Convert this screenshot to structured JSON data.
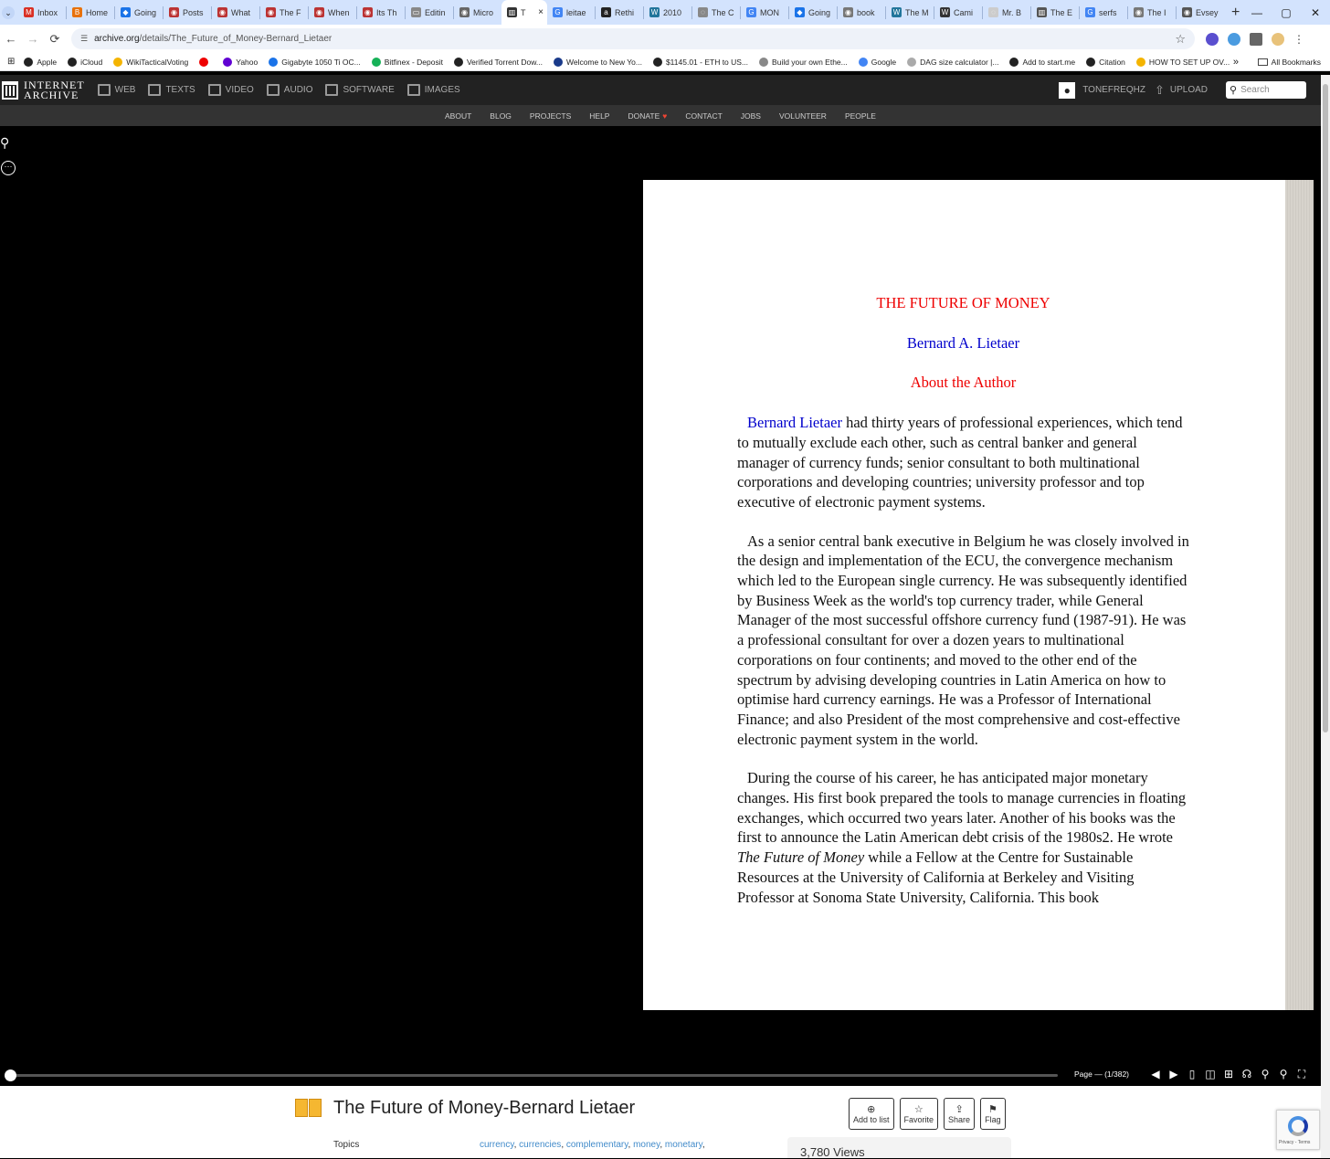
{
  "browser": {
    "tabs": [
      {
        "label": "Inbox",
        "color": "#d93025",
        "glyph": "M"
      },
      {
        "label": "Home",
        "color": "#e8710a",
        "glyph": "B"
      },
      {
        "label": "Going",
        "color": "#1a73e8",
        "glyph": "◆"
      },
      {
        "label": "Posts",
        "color": "#b33",
        "glyph": "◉"
      },
      {
        "label": "What",
        "color": "#b33",
        "glyph": "◉"
      },
      {
        "label": "The F",
        "color": "#b33",
        "glyph": "◉"
      },
      {
        "label": "When",
        "color": "#b33",
        "glyph": "◉"
      },
      {
        "label": "Its Th",
        "color": "#b33",
        "glyph": "◉"
      },
      {
        "label": "Editin",
        "color": "#888",
        "glyph": "▭"
      },
      {
        "label": "Micro",
        "color": "#666",
        "glyph": "◉"
      },
      {
        "label": "T",
        "color": "#333",
        "glyph": "▥",
        "active": true
      },
      {
        "label": "leitae",
        "color": "#4285f4",
        "glyph": "G"
      },
      {
        "label": "Rethi",
        "color": "#222",
        "glyph": "a"
      },
      {
        "label": "2010",
        "color": "#21759b",
        "glyph": "W"
      },
      {
        "label": "The C",
        "color": "#888",
        "glyph": "◌"
      },
      {
        "label": "MON",
        "color": "#4285f4",
        "glyph": "G"
      },
      {
        "label": "Going",
        "color": "#1a73e8",
        "glyph": "◆"
      },
      {
        "label": "book",
        "color": "#777",
        "glyph": "◉"
      },
      {
        "label": "The M",
        "color": "#21759b",
        "glyph": "W"
      },
      {
        "label": "Cami",
        "color": "#333",
        "glyph": "W"
      },
      {
        "label": "Mr. B",
        "color": "#ccc",
        "glyph": "◌"
      },
      {
        "label": "The E",
        "color": "#555",
        "glyph": "▥"
      },
      {
        "label": "serfs",
        "color": "#4285f4",
        "glyph": "G"
      },
      {
        "label": "The I",
        "color": "#777",
        "glyph": "◉"
      },
      {
        "label": "Evsey",
        "color": "#555",
        "glyph": "◉"
      }
    ],
    "close_tab_glyph": "×",
    "new_tab_glyph": "+",
    "window_controls": [
      "⌄",
      "—",
      "▢",
      "✕"
    ],
    "nav": {
      "back": "←",
      "forward": "→",
      "reload": "⟳"
    },
    "url_host": "archive.org",
    "url_path": "/details/The_Future_of_Money-Bernard_Lietaer",
    "bookmark_star": "☆",
    "bookmarks": [
      {
        "label": "Apple",
        "color": "#222"
      },
      {
        "label": "iCloud",
        "color": "#222"
      },
      {
        "label": "WikiTacticalVoting",
        "color": "#f4b400"
      },
      {
        "label": "",
        "color": "#e00"
      },
      {
        "label": "Yahoo",
        "color": "#6001d2"
      },
      {
        "label": "Gigabyte 1050 Ti OC...",
        "color": "#1a73e8"
      },
      {
        "label": "Bitfinex - Deposit",
        "color": "#16b157"
      },
      {
        "label": "Verified Torrent Dow...",
        "color": "#222"
      },
      {
        "label": "Welcome to New Yo...",
        "color": "#1a3a8a"
      },
      {
        "label": "$1145.01 - ETH to US...",
        "color": "#222"
      },
      {
        "label": "Build your own Ethe...",
        "color": "#888"
      },
      {
        "label": "Google",
        "color": "#4285f4"
      },
      {
        "label": "DAG size calculator |...",
        "color": "#aaa"
      },
      {
        "label": "Add to start.me",
        "color": "#222"
      },
      {
        "label": "Citation",
        "color": "#222"
      },
      {
        "label": "HOW TO SET UP OV...",
        "color": "#f4b400"
      }
    ],
    "bookmarks_more": "»",
    "all_bookmarks": "All Bookmarks"
  },
  "ia_nav": {
    "logo_line1": "INTERNET",
    "logo_line2": "ARCHIVE",
    "media": [
      "WEB",
      "TEXTS",
      "VIDEO",
      "AUDIO",
      "SOFTWARE",
      "IMAGES"
    ],
    "user": "TONEFREQHZ",
    "upload": "UPLOAD",
    "search_placeholder": "Search",
    "sub": [
      "ABOUT",
      "BLOG",
      "PROJECTS",
      "HELP",
      "DONATE",
      "CONTACT",
      "JOBS",
      "VOLUNTEER",
      "PEOPLE"
    ]
  },
  "reader": {
    "page": {
      "title": "THE FUTURE OF MONEY",
      "author": "Bernard A. Lietaer",
      "about": "About the Author",
      "p1_link": "Bernard Lietaer",
      "p1_rest": " had thirty years of professional experiences, which tend to mutually exclude each other, such as central banker and general manager of currency funds; senior consultant to both multinational corporations and developing countries; university professor and top executive of electronic payment systems.",
      "p2": "As a senior central bank executive in Belgium he was closely involved in the design and implementation of the ECU, the convergence mechanism which led to the European single currency. He was subsequently identified by Business Week as the world's top currency trader, while General Manager of the most successful offshore currency fund (1987-91). He was a professional consultant for over a dozen years to multinational corporations on four continents; and moved to the other end of the spectrum by advising developing countries in Latin America on how to optimise hard currency earnings. He was a Professor of International Finance; and also President of the most comprehensive and cost-effective electronic payment system in the world.",
      "p3_a": "During the course of his career, he has anticipated major monetary changes. His first book prepared the tools to manage currencies in floating exchanges, which occurred two years later. Another of his books was the first to announce the Latin American debt crisis of the 1980s2. He wrote ",
      "p3_italic": "The Future of Money",
      "p3_b": " while a Fellow at the Centre for Sustainable Resources at the University of California at Berkeley and Visiting Professor at Sonoma State University, California. This book"
    },
    "page_indicator": "Page — (1/382)",
    "progress": 0.0026
  },
  "meta": {
    "title": "The Future of Money-Bernard Lietaer",
    "actions": [
      {
        "icon": "⊕",
        "label": "Add to list"
      },
      {
        "icon": "☆",
        "label": "Favorite"
      },
      {
        "icon": "⇪",
        "label": "Share"
      },
      {
        "icon": "⚑",
        "label": "Flag"
      }
    ],
    "topics_label": "Topics",
    "topics": [
      "currency",
      "currencies",
      "complementary",
      "money",
      "monetary"
    ],
    "views": "3,780 Views",
    "recaptcha_text": "Privacy - Terms"
  }
}
